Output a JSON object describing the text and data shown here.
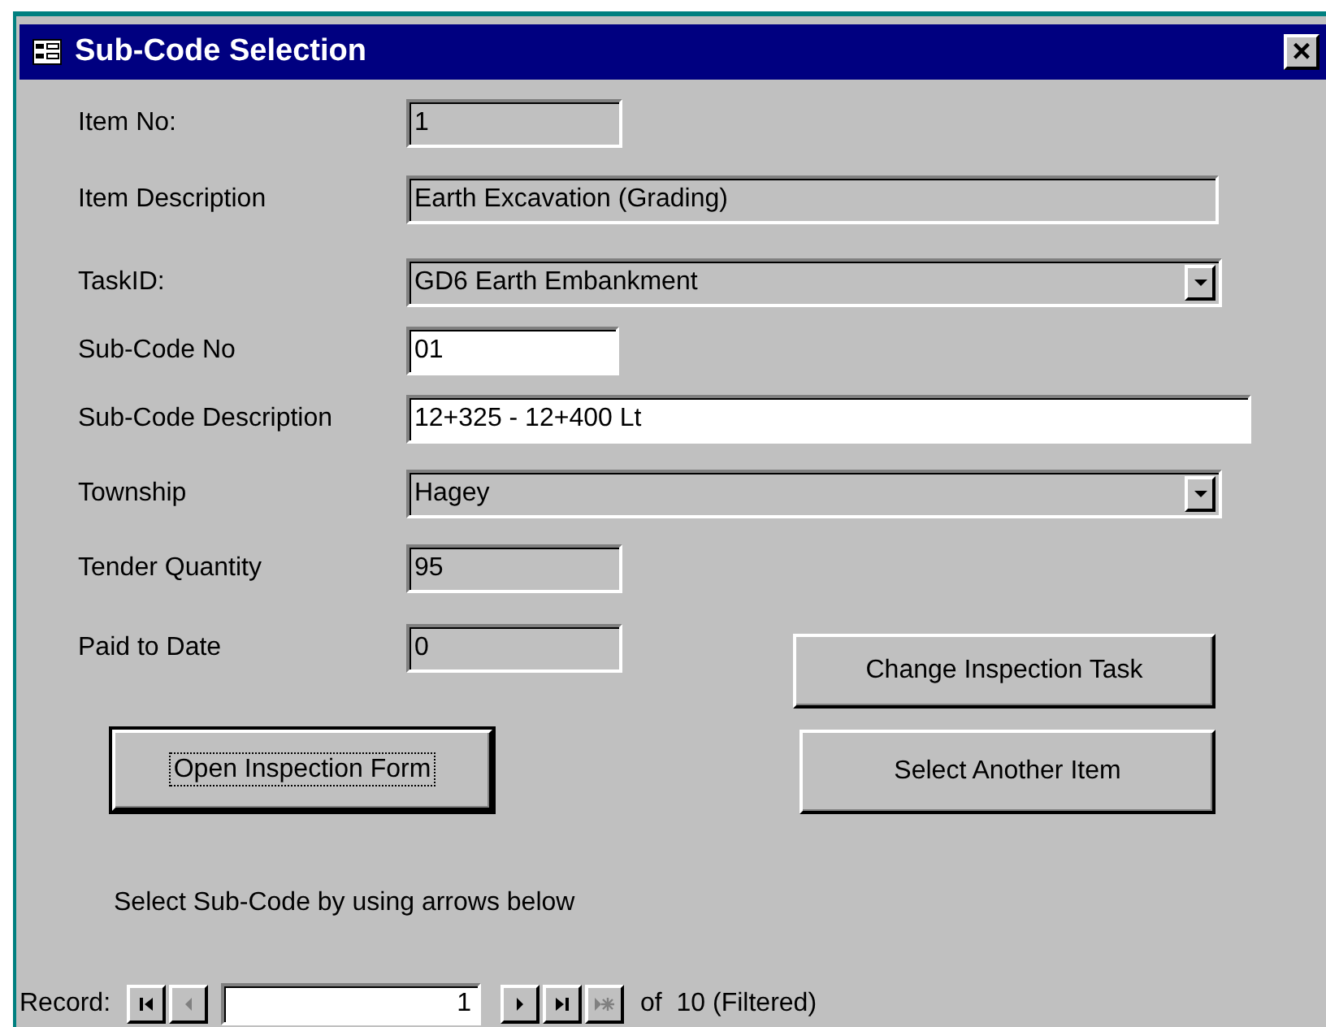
{
  "window": {
    "title": "Sub-Code Selection",
    "close": "×"
  },
  "fields": [
    {
      "label": "Item No:",
      "kind": "readonly",
      "value": "1"
    },
    {
      "label": "Item Description",
      "kind": "readonly",
      "value": "Earth Excavation (Grading)"
    },
    {
      "label": "TaskID:",
      "kind": "combo",
      "value": "GD6 Earth Embankment"
    },
    {
      "label": "Sub-Code No",
      "kind": "text",
      "value": "01"
    },
    {
      "label": "Sub-Code Description",
      "kind": "text",
      "value": "12+325 - 12+400 Lt"
    },
    {
      "label": "Township",
      "kind": "combo",
      "value": "Hagey"
    },
    {
      "label": "Tender Quantity",
      "kind": "readonly",
      "value": "95"
    },
    {
      "label": "Paid to Date",
      "kind": "readonly",
      "value": "0"
    }
  ],
  "buttons": [
    {
      "label": "Change Inspection Task",
      "focused": false
    },
    {
      "label": "Open Inspection Form",
      "focused": true
    },
    {
      "label": "Select Another Item",
      "focused": false
    }
  ],
  "hint": "Select Sub-Code by using arrows below",
  "record_nav": {
    "label": "Record:",
    "value": "1",
    "total": "of  10 (Filtered)",
    "buttons": [
      {
        "kind": "first",
        "disabled": false
      },
      {
        "kind": "prev",
        "disabled": true
      },
      {
        "kind": "next",
        "disabled": false
      },
      {
        "kind": "last",
        "disabled": false
      },
      {
        "kind": "new",
        "disabled": true
      }
    ]
  }
}
